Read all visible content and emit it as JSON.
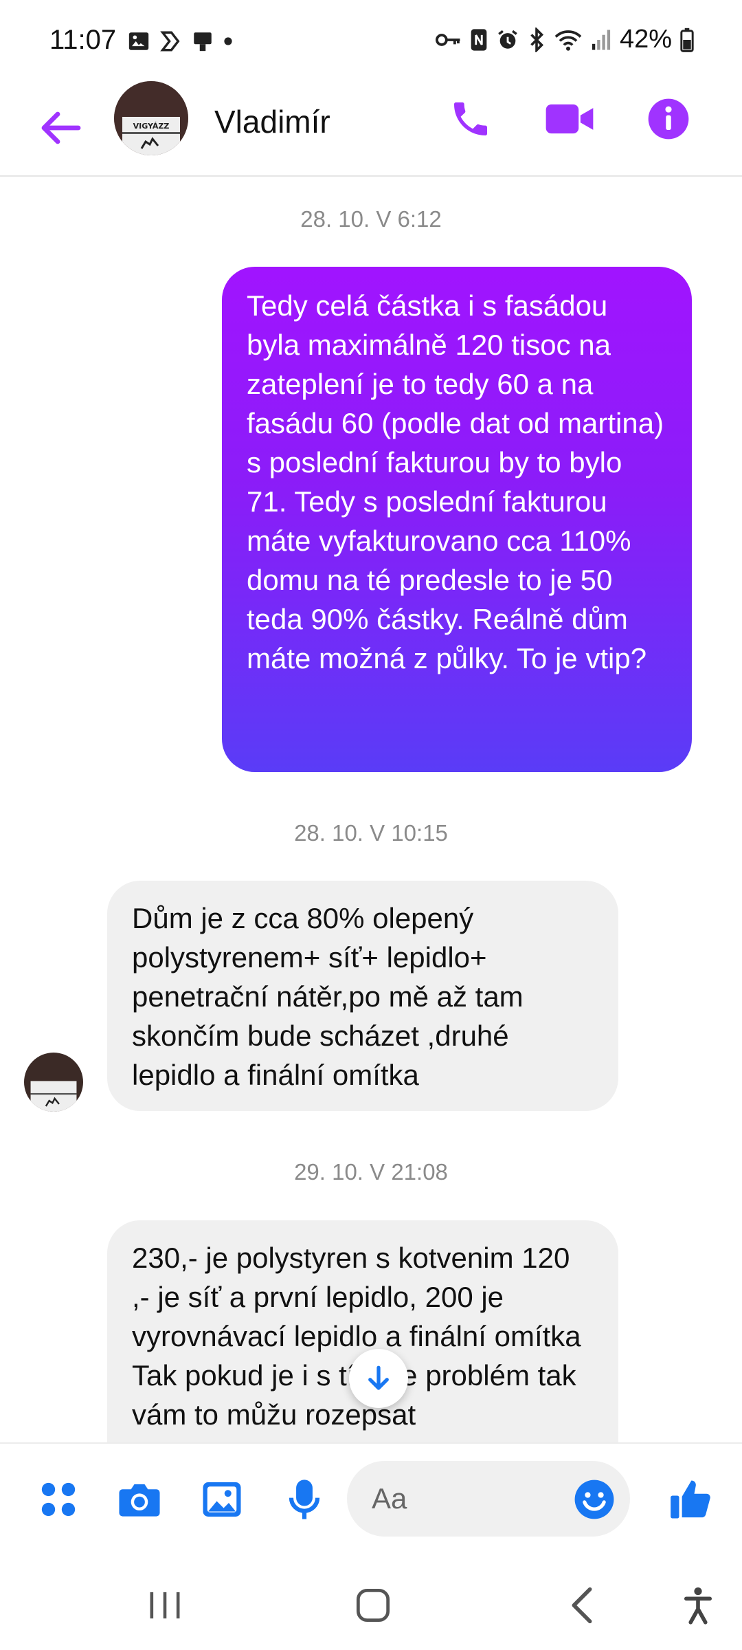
{
  "status_bar": {
    "time": "11:07",
    "battery": "42%"
  },
  "header": {
    "contact_name": "Vladimír",
    "avatar_sign_text": "VIGYÁZZ"
  },
  "colors": {
    "accent": "#a033ff",
    "bubble_out_top": "#a114ff",
    "bubble_out_bottom": "#5a3cf7",
    "bubble_in": "#f0f0f0",
    "composer_icon": "#1877f2"
  },
  "messages": [
    {
      "type": "timestamp",
      "text": "28. 10. V 6:12"
    },
    {
      "type": "outgoing",
      "text": "Tedy celá částka i s fasádou byla maximálně 120 tisoc na zateplení je to tedy 60 a na fasádu 60 (podle dat od martina) s poslední fakturou by to bylo 71. Tedy s poslední fakturou máte vyfakturovano cca 110% domu na té predesle to je 50 teda 90% částky. Reálně dům máte možná z půlky. To je vtip?"
    },
    {
      "type": "timestamp",
      "text": "28. 10. V 10:15"
    },
    {
      "type": "incoming",
      "text": "Dům je z cca 80% olepený polystyrenem+ síť+ lepidlo+ penetrační nátěr,po mě až tam skončím bude scházet ,druhé lepidlo a finální omítka"
    },
    {
      "type": "timestamp",
      "text": "29. 10. V 21:08"
    },
    {
      "type": "incoming",
      "text": "230,- je polystyren s kotvenim 120 ,- je síť a první lepidlo, 200 je vyrovnávací lepidlo a finální omítka Tak pokud je i s tímhle problém tak vám to můžu rozepsat"
    }
  ],
  "composer": {
    "placeholder": "Aa"
  },
  "icons": {
    "back": "arrow-left-icon",
    "call": "phone-icon",
    "video": "video-camera-icon",
    "info": "info-icon",
    "menu": "four-dots-menu-icon",
    "camera": "camera-icon",
    "gallery": "image-icon",
    "voice": "microphone-icon",
    "emoji": "smiley-icon",
    "like": "thumbs-up-icon",
    "scroll": "arrow-down-icon"
  }
}
